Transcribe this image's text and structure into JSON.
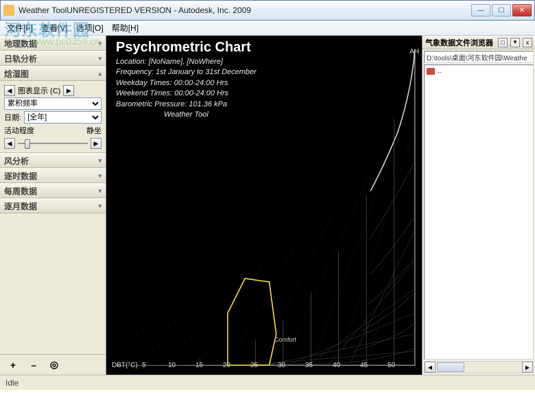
{
  "window": {
    "title": "Weather ToolUNREGISTERED VERSION -   Autodesk, Inc. 2009"
  },
  "menus": [
    "文件[F]",
    "查看[V]",
    "选项[O]",
    "帮助[H]"
  ],
  "sidebar": {
    "panels": {
      "p1": "地理数据",
      "p2": "日轨分析",
      "p3": "焓湿图",
      "p4": "风分析",
      "p5": "逐时数据",
      "p6": "每周数据",
      "p7": "逐月数据"
    },
    "chart_display_label": "图表显示 (C)",
    "select1": "累积频率",
    "date_label": "日期:",
    "date_value": "[全年]",
    "activity_label": "活动程度",
    "activity_value": "静坐"
  },
  "chart": {
    "title": "Psychrometric Chart",
    "location": "Location: [NoName], [NoWhere]",
    "frequency": "Frequency: 1st January to 31st December",
    "weekday": "Weekday Times: 00:00-24:00 Hrs",
    "weekend": "Weekend Times: 00:00-24:00 Hrs",
    "pressure": "Barometric Pressure: 101.36 kPa",
    "tool": "Weather Tool",
    "xaxis": "DBT(°C)",
    "yaxis": "AH",
    "comfort": "Comfort",
    "xticks": [
      "5",
      "10",
      "15",
      "20",
      "25",
      "30",
      "35",
      "40",
      "45",
      "50"
    ]
  },
  "chart_data": {
    "type": "psychrometric",
    "x_variable": "Dry Bulb Temperature (°C)",
    "y_variable": "Absolute Humidity",
    "x_range": [
      0,
      55
    ],
    "xticks": [
      5,
      10,
      15,
      20,
      25,
      30,
      35,
      40,
      45,
      50
    ],
    "barometric_pressure_kPa": 101.36,
    "period": "1 Jan – 31 Dec",
    "weekday_hours": "00:00-24:00",
    "weekend_hours": "00:00-24:00",
    "overlay": "累积频率 (cumulative frequency)",
    "comfort_zone_dbt_range_c": [
      18,
      26
    ]
  },
  "browser": {
    "title": "气象数据文件浏览器",
    "path": "D:\\tools\\桌面\\河东软件园\\Weathe",
    "item_up": ".."
  },
  "status": "Idle",
  "watermark": {
    "main": "河东软件园",
    "sub": "www.pc0359.cn"
  },
  "icons": {
    "min": "—",
    "max": "☐",
    "close": "✕",
    "left": "◀",
    "right": "▶",
    "dd": "▾",
    "pin": "□",
    "x": "x",
    "plus": "+",
    "minus": "–",
    "target": "◎"
  }
}
